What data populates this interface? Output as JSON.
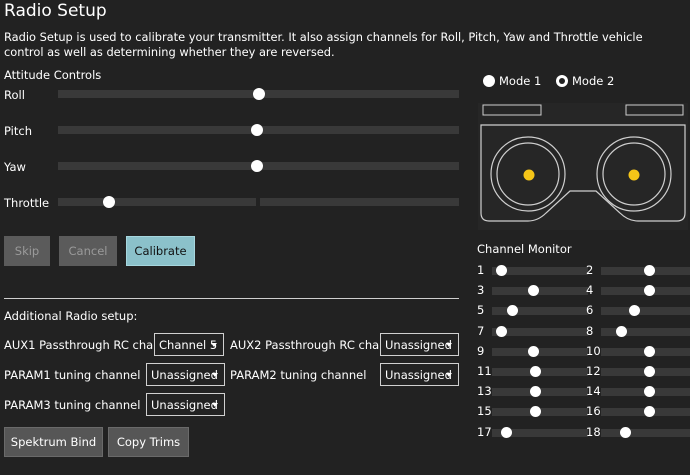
{
  "title": "Radio Setup",
  "description": "Radio Setup is used to calibrate your transmitter. It also assign channels for Roll, Pitch, Yaw and Throttle vehicle control as well as determining whether they are reversed.",
  "attitude": {
    "heading": "Attitude Controls",
    "controls": [
      {
        "label": "Roll",
        "value": 0.5
      },
      {
        "label": "Pitch",
        "value": 0.5
      },
      {
        "label": "Yaw",
        "value": 0.5
      },
      {
        "label": "Throttle",
        "value": 0.13
      }
    ]
  },
  "buttons": {
    "skip": "Skip",
    "cancel": "Cancel",
    "calibrate": "Calibrate"
  },
  "additional": {
    "heading": "Additional Radio setup:",
    "aux1_label": "AUX1 Passthrough RC channel",
    "aux1_value": "Channel 5",
    "aux2_label": "AUX2 Passthrough RC channel",
    "aux2_value": "Unassigned",
    "param1_label": "PARAM1 tuning channel",
    "param1_value": "Unassigned",
    "param2_label": "PARAM2 tuning channel",
    "param2_value": "Unassigned",
    "param3_label": "PARAM3 tuning channel",
    "param3_value": "Unassigned"
  },
  "bottom_buttons": {
    "spektrum": "Spektrum Bind",
    "copy_trims": "Copy Trims"
  },
  "mode": {
    "mode1": "Mode 1",
    "mode2": "Mode 2",
    "selected": "Mode 2"
  },
  "monitor": {
    "heading": "Channel Monitor",
    "channels": [
      {
        "num": "1",
        "value": 0.05
      },
      {
        "num": "2",
        "value": 0.5
      },
      {
        "num": "3",
        "value": 0.42
      },
      {
        "num": "4",
        "value": 0.5
      },
      {
        "num": "5",
        "value": 0.18
      },
      {
        "num": "6",
        "value": 0.33
      },
      {
        "num": "7",
        "value": 0.05
      },
      {
        "num": "8",
        "value": 0.18
      },
      {
        "num": "9",
        "value": 0.42
      },
      {
        "num": "10",
        "value": 0.5
      },
      {
        "num": "11",
        "value": 0.45
      },
      {
        "num": "12",
        "value": 0.5
      },
      {
        "num": "13",
        "value": 0.45
      },
      {
        "num": "14",
        "value": 0.5
      },
      {
        "num": "15",
        "value": 0.45
      },
      {
        "num": "16",
        "value": 0.5
      },
      {
        "num": "17",
        "value": 0.1
      },
      {
        "num": "18",
        "value": 0.22
      }
    ]
  },
  "colors": {
    "accent": "#8bc1ca",
    "stick_dot": "#f5c518"
  }
}
